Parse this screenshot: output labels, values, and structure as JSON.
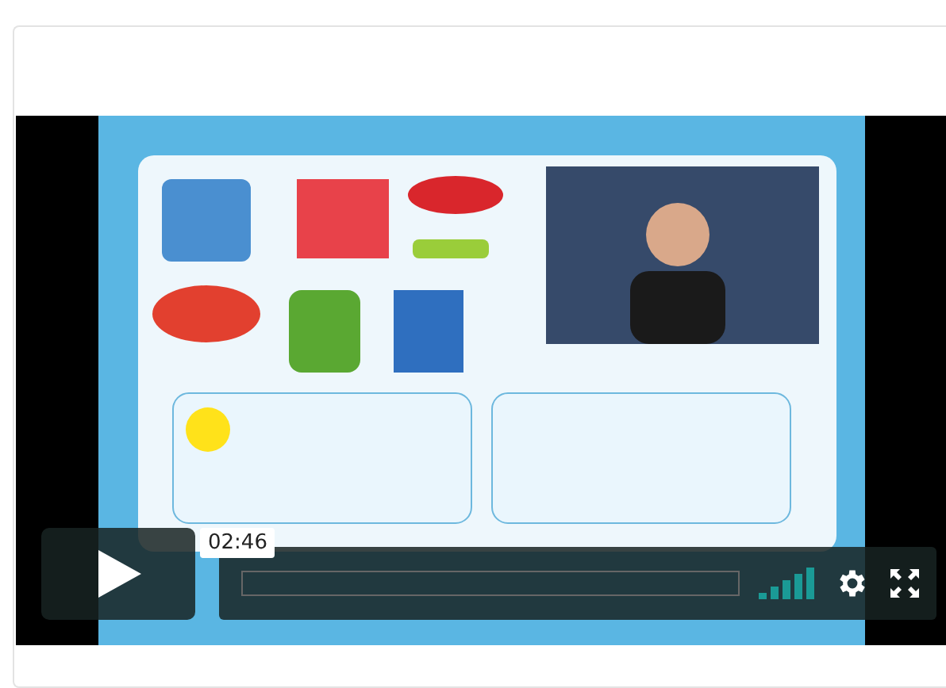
{
  "player": {
    "timestamp": "02:46",
    "progress": {
      "level": 0
    }
  }
}
